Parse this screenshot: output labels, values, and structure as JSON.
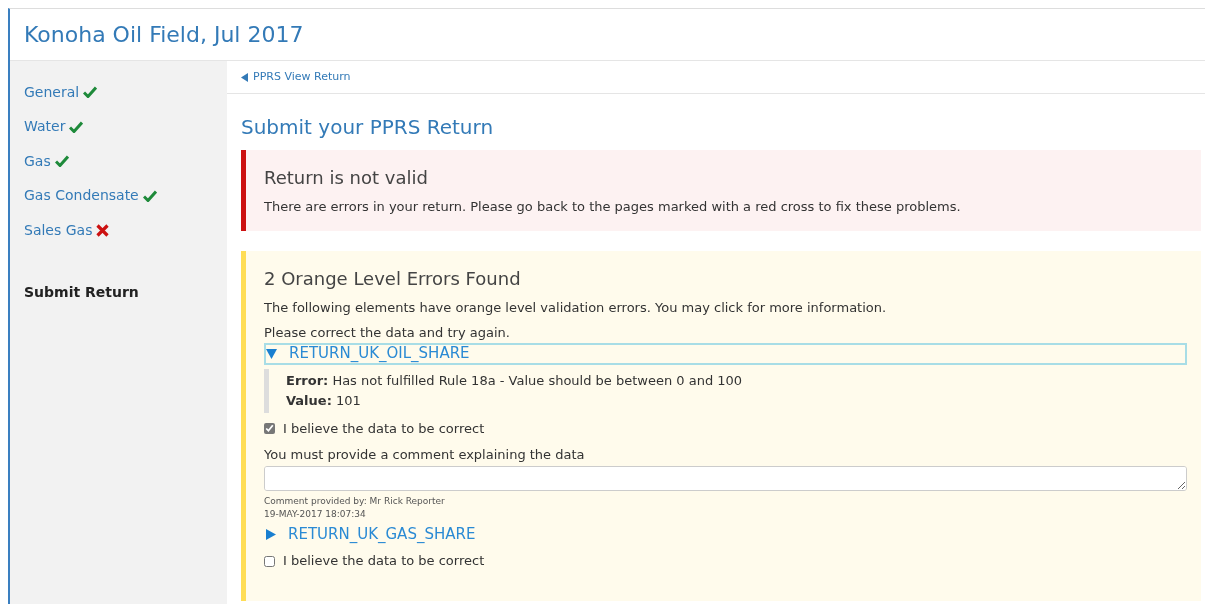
{
  "header": {
    "title": "Konoha Oil Field, Jul 2017"
  },
  "sidebar": {
    "items": [
      {
        "label": "General",
        "valid": true,
        "selected": false
      },
      {
        "label": "Water",
        "valid": true,
        "selected": false
      },
      {
        "label": "Gas",
        "valid": true,
        "selected": false
      },
      {
        "label": "Gas Condensate",
        "valid": true,
        "selected": false
      },
      {
        "label": "Sales Gas",
        "valid": false,
        "selected": false
      }
    ],
    "submit": {
      "label": "Submit Return",
      "selected": true
    }
  },
  "breadcrumb": {
    "label": "PPRS View Return"
  },
  "page_title": "Submit your PPRS Return",
  "invalid_alert": {
    "title": "Return is not valid",
    "message": "There are errors in your return. Please go back to the pages marked with a red cross to fix these problems."
  },
  "warning_panel": {
    "title": "2 Orange Level Errors Found",
    "intro": "The following elements have orange level validation errors. You may click for more information.",
    "instruction": "Please correct the data and try again.",
    "errors": [
      {
        "name": "RETURN_UK_OIL_SHARE",
        "expanded": true,
        "focused": true,
        "details": [
          "**Error:** Has not fulfilled Rule 18a - Value should be between 0 and 100",
          "**Value:** 101"
        ],
        "confirm_label": "I believe the data to be correct",
        "checked": true,
        "comment_label": "You must provide a comment explaining the data",
        "comment_meta": [
          "Comment provided by: Mr Rick Reporter",
          "19-MAY-2017 18:07:34"
        ]
      },
      {
        "name": "RETURN_UK_GAS_SHARE",
        "expanded": false,
        "focused": false,
        "confirm_label": "I believe the data to be correct",
        "checked": false
      }
    ]
  }
}
